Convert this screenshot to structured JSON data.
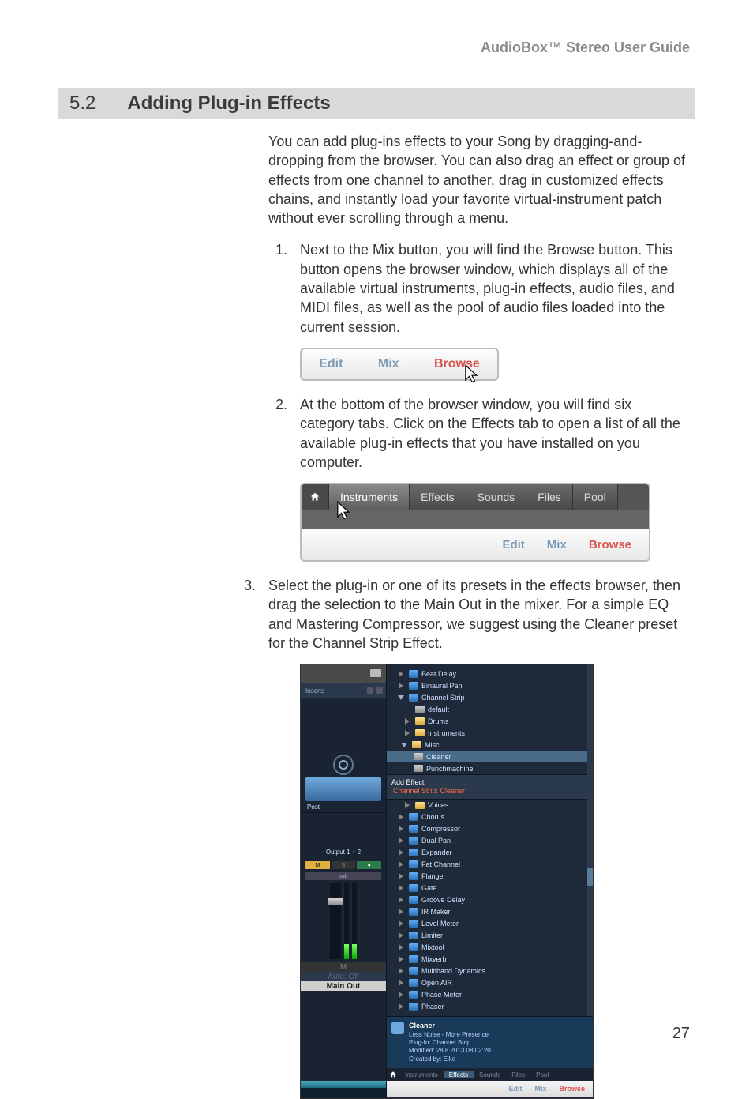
{
  "running_header": "AudioBox™ Stereo User Guide",
  "section": {
    "num": "5.2",
    "title": "Adding Plug-in Effects"
  },
  "intro": "You can add plug-ins effects to your Song by dragging-and-dropping from the browser. You can also drag an effect or group of effects from one channel to another, drag in customized effects chains, and instantly load your favorite virtual-instrument patch without ever scrolling through a menu.",
  "steps": {
    "1": "Next to the Mix button, you will find the Browse button. This button opens the browser window, which displays all of the available virtual instruments, plug-in effects, audio files, and MIDI files, as well as the pool of audio files loaded into the current session.",
    "2": "At the bottom of the browser window, you will find six category tabs. Click on the Effects tab to open a list of all the available plug-in effects that you have installed on you computer.",
    "3": "Select the plug-in or one of its presets in the effects browser, then drag the selection to the Main Out in the mixer. For a simple EQ and Mastering Compressor, we suggest using the Cleaner preset for the Channel Strip Effect."
  },
  "fig1_toolbar": {
    "edit": "Edit",
    "mix": "Mix",
    "browse": "Browse"
  },
  "fig2": {
    "tabs": {
      "instruments": "Instruments",
      "effects": "Effects",
      "sounds": "Sounds",
      "files": "Files",
      "pool": "Pool"
    },
    "toolbar": {
      "edit": "Edit",
      "mix": "Mix",
      "browse": "Browse"
    }
  },
  "fig3": {
    "mixer": {
      "inserts": "Inserts",
      "post": "Post",
      "output": "Output 1 + 2",
      "sub": "sub",
      "m_label": "M",
      "s_label": "S",
      "ch_m": "M",
      "ch_s": "S",
      "auto": "Auto: Off",
      "main_out": "Main Out"
    },
    "tree_top": [
      {
        "label": "Beat Delay",
        "type": "fx"
      },
      {
        "label": "Binaural Pan",
        "type": "fx"
      },
      {
        "label": "Channel Strip",
        "type": "fx",
        "expanded": true
      }
    ],
    "tree_chstrip": [
      {
        "label": "default",
        "type": "preset"
      },
      {
        "label": "Drums",
        "type": "folder"
      },
      {
        "label": "Instruments",
        "type": "folder"
      },
      {
        "label": "Misc",
        "type": "folder",
        "expanded": true
      }
    ],
    "tree_misc": [
      {
        "label": "Cleaner",
        "type": "preset",
        "selected": true
      },
      {
        "label": "Punchmachine",
        "type": "preset"
      }
    ],
    "add_effect": {
      "label": "Add Effect:",
      "value": "Channel Strip: Cleaner"
    },
    "tree_voices_folder": "Voices",
    "tree_bottom": [
      "Chorus",
      "Compressor",
      "Dual Pan",
      "Expander",
      "Fat Channel",
      "Flanger",
      "Gate",
      "Groove Delay",
      "IR Maker",
      "Level Meter",
      "Limiter",
      "Mixtool",
      "Mixverb",
      "Multiband Dynamics",
      "Open AIR",
      "Phase Meter",
      "Phaser"
    ],
    "infobox": {
      "title": "Cleaner",
      "sub": "Less Noise - More Presence",
      "plugin_label": "Plug-In:",
      "plugin": "Channel Strip",
      "modified_label": "Modified:",
      "modified": "28.8.2013 08:02:20",
      "created_label": "Created by:",
      "created": "Elke"
    },
    "tabs": {
      "instruments": "Instruments",
      "effects": "Effects",
      "sounds": "Sounds",
      "files": "Files",
      "pool": "Pool"
    },
    "toolbar": {
      "edit": "Edit",
      "mix": "Mix",
      "browse": "Browse"
    }
  },
  "page_num": "27"
}
